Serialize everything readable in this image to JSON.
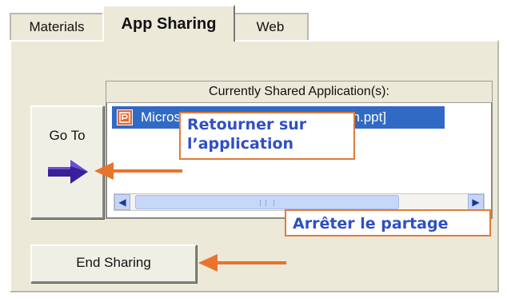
{
  "tabs": [
    {
      "label": "Materials",
      "active": false
    },
    {
      "label": "App Sharing",
      "active": true
    },
    {
      "label": "Web",
      "active": false
    }
  ],
  "goto_button": {
    "label": "Go To",
    "arrow_icon": "arrow-right-icon",
    "arrow_color": "#3b1f9a"
  },
  "shared_list": {
    "header": "Currently Shared Application(s):",
    "items": [
      {
        "label": "Microsoft PowerPoint - [presentation.ppt]",
        "icon": "powerpoint-icon",
        "selected": true
      }
    ],
    "scrollbar": {
      "left_icon": "chevron-left-icon",
      "right_icon": "chevron-right-icon",
      "grip": "III"
    }
  },
  "end_button": {
    "label": "End Sharing"
  },
  "annotations": {
    "retour": {
      "line1": "Retourner sur",
      "line2": "l’application"
    },
    "arreter": {
      "label": "Arrêter le partage"
    },
    "arrow_color": "#e8742c",
    "text_color": "#2f4fc6"
  },
  "colors": {
    "panel_bg": "#ece9d8",
    "selection_bg": "#316ac5"
  }
}
